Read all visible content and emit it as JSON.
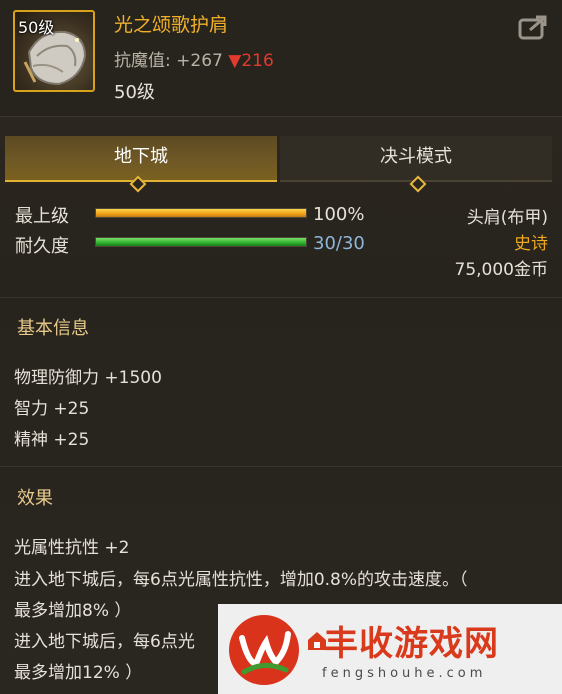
{
  "item": {
    "icon_level": "50级",
    "name": "光之颂歌护肩",
    "resist_label": "抗魔值:",
    "resist_value": "+267",
    "resist_down": "▼216",
    "required_level": "50级",
    "icon": "shoulder-armor-icon"
  },
  "tabs": [
    {
      "label": "地下城",
      "active": true
    },
    {
      "label": "决斗模式",
      "active": false
    }
  ],
  "stats": {
    "upgrade_label": "最上级",
    "upgrade_value": "100%",
    "upgrade_fraction": 1.0,
    "durability_label": "耐久度",
    "durability_value": "30/30",
    "durability_fraction": 1.0
  },
  "meta": {
    "slot": "头肩(布甲)",
    "rarity": "史诗",
    "price": "75,000金币"
  },
  "basic_info": {
    "title": "基本信息",
    "lines": [
      "物理防御力 +1500",
      "智力 +25",
      "精神 +25"
    ]
  },
  "effects": {
    "title": "效果",
    "lines": [
      "光属性抗性 +2",
      "进入地下城后，每6点光属性抗性，增加0.8%的攻击速度。（",
      "最多增加8% ）",
      "进入地下城后，每6点光",
      "最多增加12% ）"
    ]
  },
  "watermark": {
    "title": "丰收游戏网",
    "subtitle": "fengshouhe.com"
  },
  "colors": {
    "gold": "#f0b02a",
    "red": "#e23a2d",
    "green_bar": "#2fb12c",
    "orange_bar": "#f1a019",
    "rarity": "#f0a81e",
    "durability_text": "#8fb6d8"
  }
}
